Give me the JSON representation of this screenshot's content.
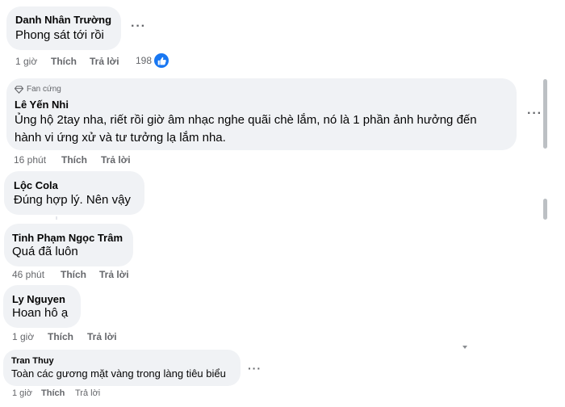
{
  "comments": [
    {
      "author": "Danh Nhân Trường",
      "text": "Phong sát tới rồi",
      "time": "1 giờ",
      "like_label": "Thích",
      "reply_label": "Trả lời",
      "reaction_count": "198",
      "reaction_icon": "like-icon"
    },
    {
      "badge": "Fan cứng",
      "badge_icon": "diamond-icon",
      "author": "Lê Yến Nhi",
      "text_line1": "Ủng hộ 2tay nha, riết rồi giờ âm nhạc nghe quãi chè lắm, nó là 1 phần ảnh hưởng đến",
      "text_line2": "hành vi ứng xử và tư tưởng lạ lắm nha.",
      "time": "16 phút",
      "like_label": "Thích",
      "reply_label": "Trả lời"
    },
    {
      "author": "Lộc Cola",
      "text": "Đúng hợp lý. Nên vậy"
    },
    {
      "author": "Tinh Phạm Ngọc Trâm",
      "text": "Quá đã luôn",
      "time": "46 phút",
      "like_label": "Thích",
      "reply_label": "Trả lời"
    },
    {
      "author": "Ly Nguyen",
      "text": "Hoan hô ạ",
      "time": "1 giờ",
      "like_label": "Thích",
      "reply_label": "Trả lời"
    },
    {
      "author": "Tran Thuy",
      "text": "Toàn các gương mặt vàng trong làng tiêu biểu",
      "time": "1 giờ",
      "like_label": "Thích",
      "reply_label": "Trả lời"
    }
  ],
  "more_options_label": "···",
  "colors": {
    "bubble": "#f0f2f5",
    "meta_text": "#65676b",
    "like_blue": "#1877f2"
  }
}
